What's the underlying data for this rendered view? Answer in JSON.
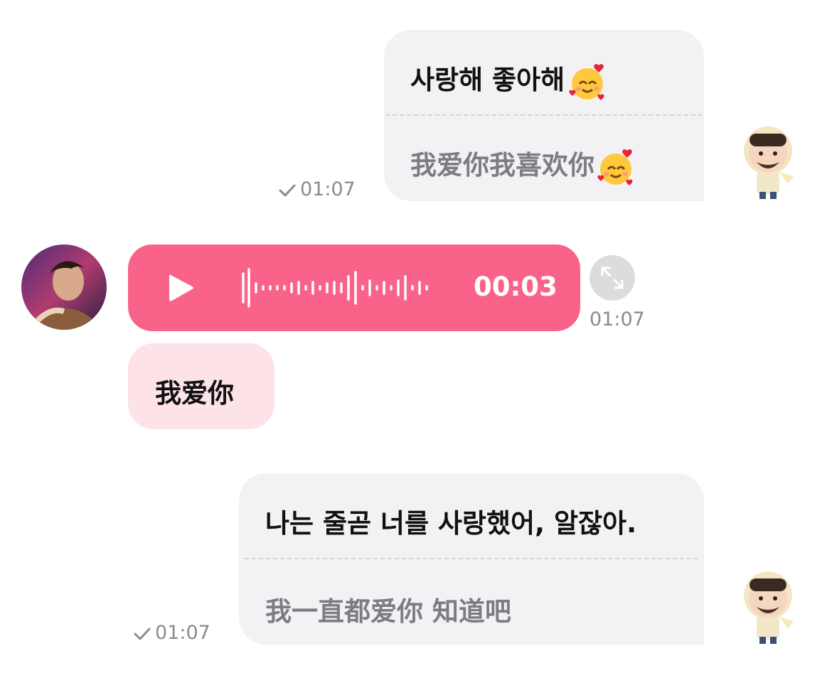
{
  "messages": [
    {
      "direction": "outgoing",
      "original": "사랑해 좋아해",
      "translation": "我爱你我喜欢你",
      "emoji": "smiling-face-with-hearts-icon",
      "time": "01:07",
      "read": true
    },
    {
      "direction": "incoming",
      "type": "voice",
      "duration": "00:03",
      "time": "01:07"
    },
    {
      "direction": "incoming",
      "type": "text",
      "text": "我爱你"
    },
    {
      "direction": "outgoing",
      "original": "나는 줄곧 너를 사랑했어, 알잖아.",
      "translation": "我一直都爱你 知道吧",
      "time": "01:07",
      "read": true
    }
  ],
  "colors": {
    "voice_bubble": "#fa6389",
    "incoming_bubble": "#fde2e8",
    "outgoing_bubble": "#f2f2f5",
    "timestamp": "#8b8b90"
  }
}
